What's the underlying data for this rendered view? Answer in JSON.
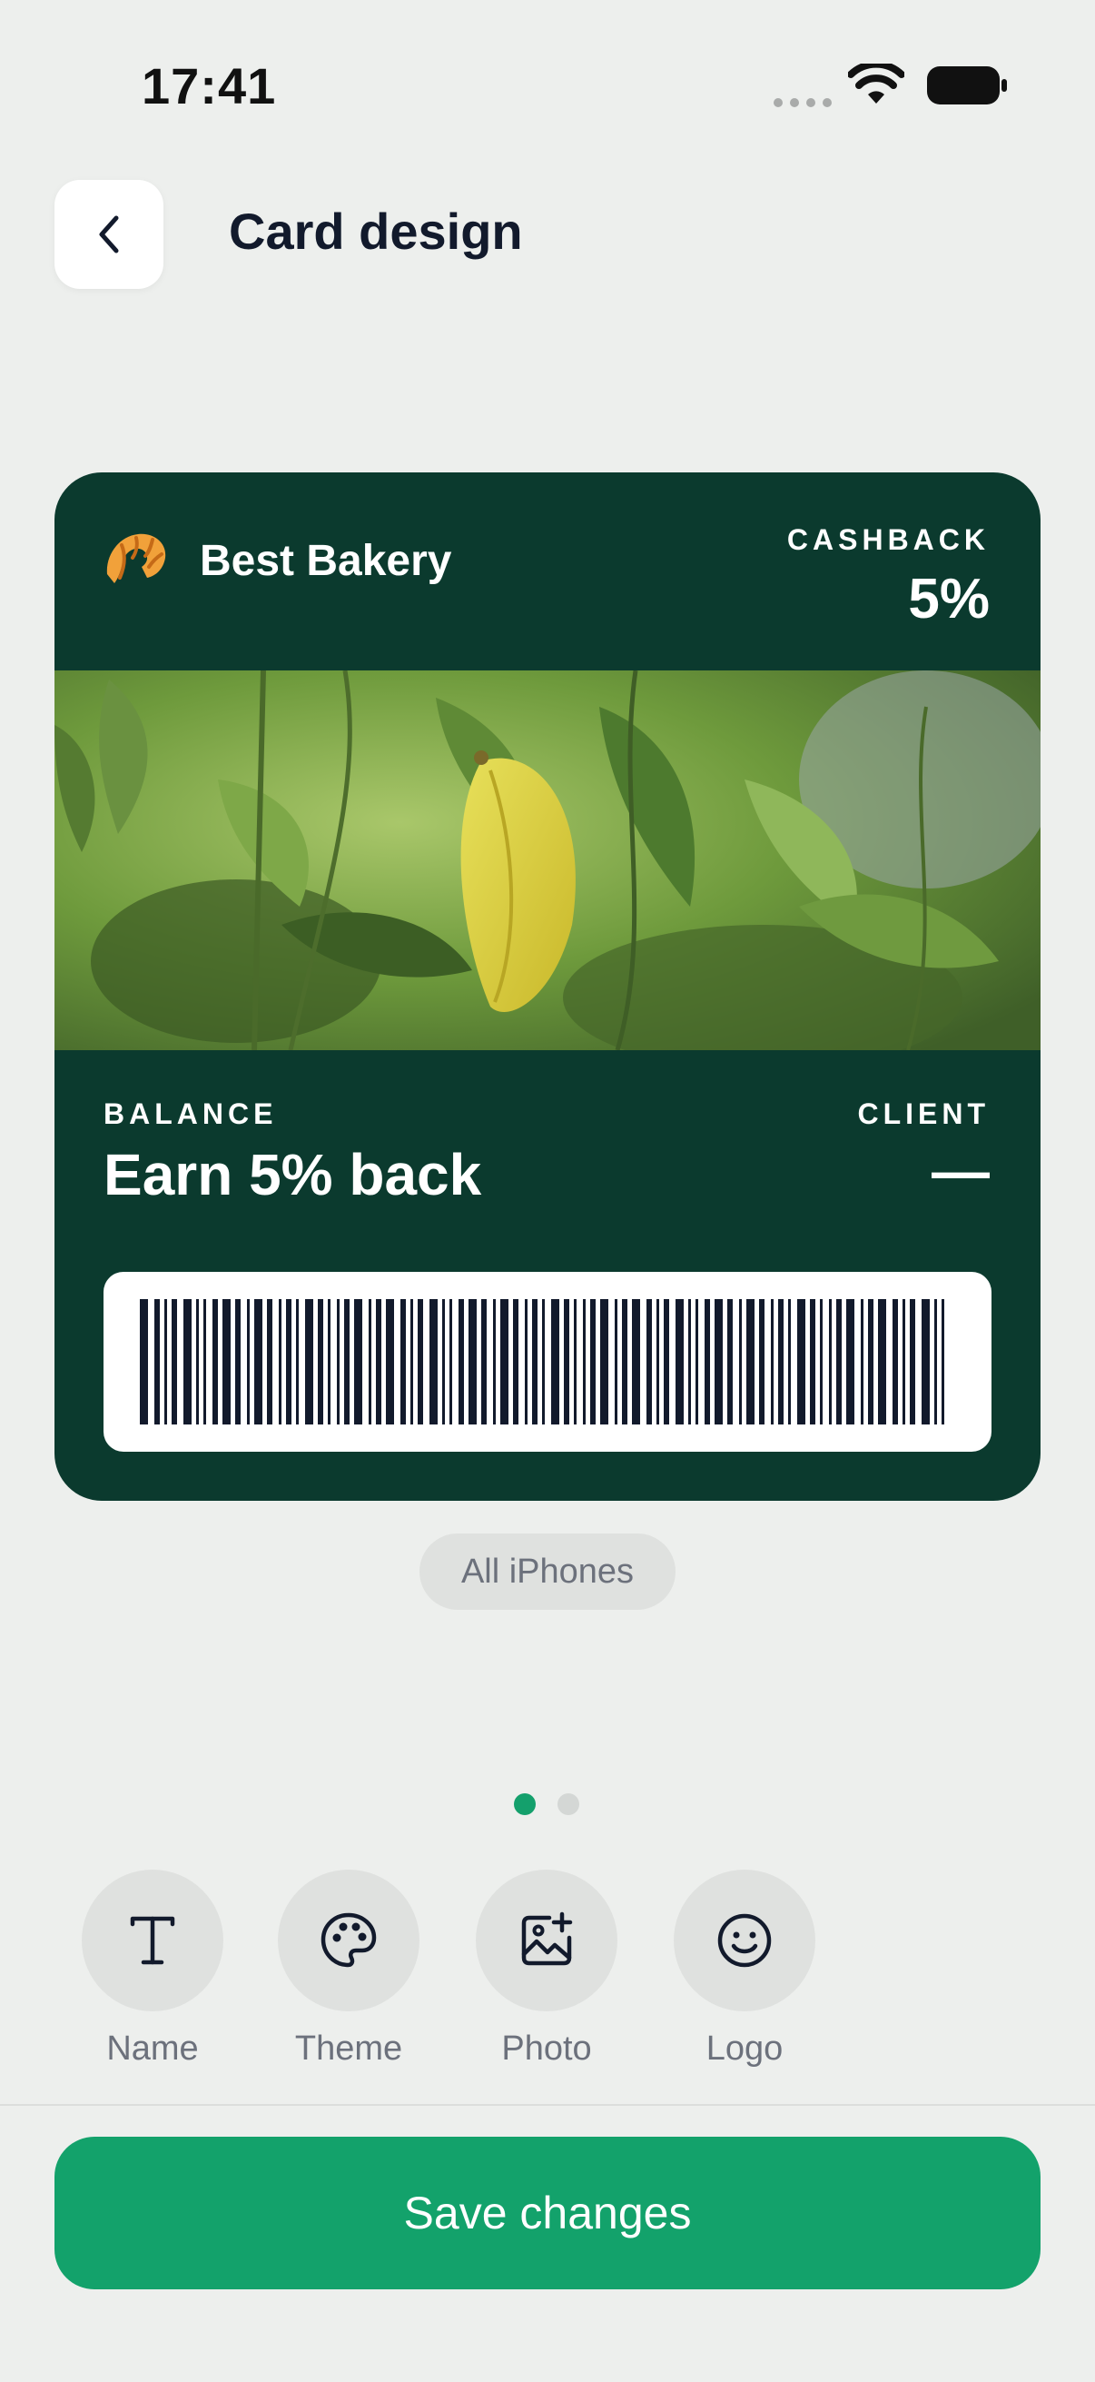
{
  "status_bar": {
    "time": "17:41"
  },
  "header": {
    "title": "Card design",
    "back_icon": "chevron-left-icon"
  },
  "card": {
    "logo_icon": "croissant-icon",
    "business_name": "Best Bakery",
    "cashback_label": "CASHBACK",
    "cashback_value": "5%",
    "photo": "green-leaves-photo",
    "balance_label": "BALANCE",
    "balance_value": "Earn 5% back",
    "client_label": "CLIENT",
    "client_value": "—",
    "colors": {
      "background": "#0b3a2e",
      "text": "#ffffff"
    }
  },
  "device_pill": {
    "label": "All iPhones"
  },
  "pager": {
    "total": 2,
    "active": 1
  },
  "tools": [
    {
      "label": "Name",
      "icon": "text-icon"
    },
    {
      "label": "Theme",
      "icon": "palette-icon"
    },
    {
      "label": "Photo",
      "icon": "image-add-icon"
    },
    {
      "label": "Logo",
      "icon": "smiley-icon"
    }
  ],
  "actions": {
    "save_label": "Save changes"
  },
  "colors": {
    "accent": "#13a26b",
    "page_background": "#edefed"
  }
}
